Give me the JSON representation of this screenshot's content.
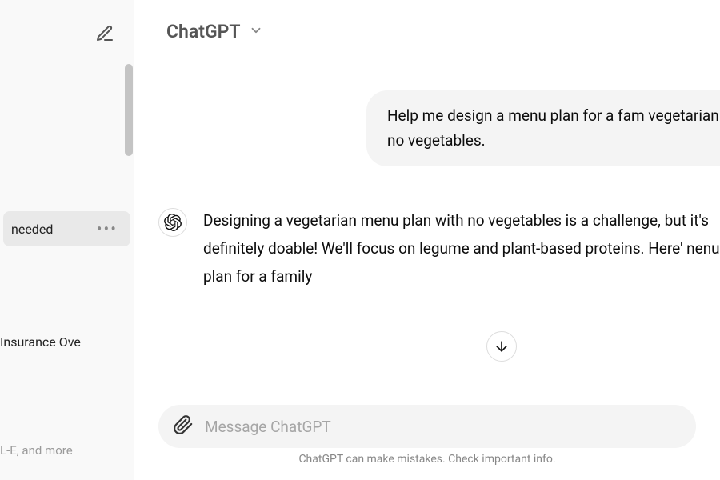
{
  "header": {
    "title": "ChatGPT"
  },
  "sidebar": {
    "items": [
      {
        "label": "needed",
        "active": true
      },
      {
        "label": "Insurance Ove",
        "active": false
      }
    ],
    "footer": "L-E, and more"
  },
  "chat": {
    "user_message": "Help me design a menu plan for a fam vegetarian no vegetables.",
    "assistant_message": "Designing a vegetarian menu plan with no vegetables is a challenge, but it's definitely doable! We'll focus on legume and plant-based proteins. Here'        nenu plan for a family"
  },
  "composer": {
    "placeholder": "Message ChatGPT"
  },
  "disclaimer": "ChatGPT can make mistakes. Check important info."
}
